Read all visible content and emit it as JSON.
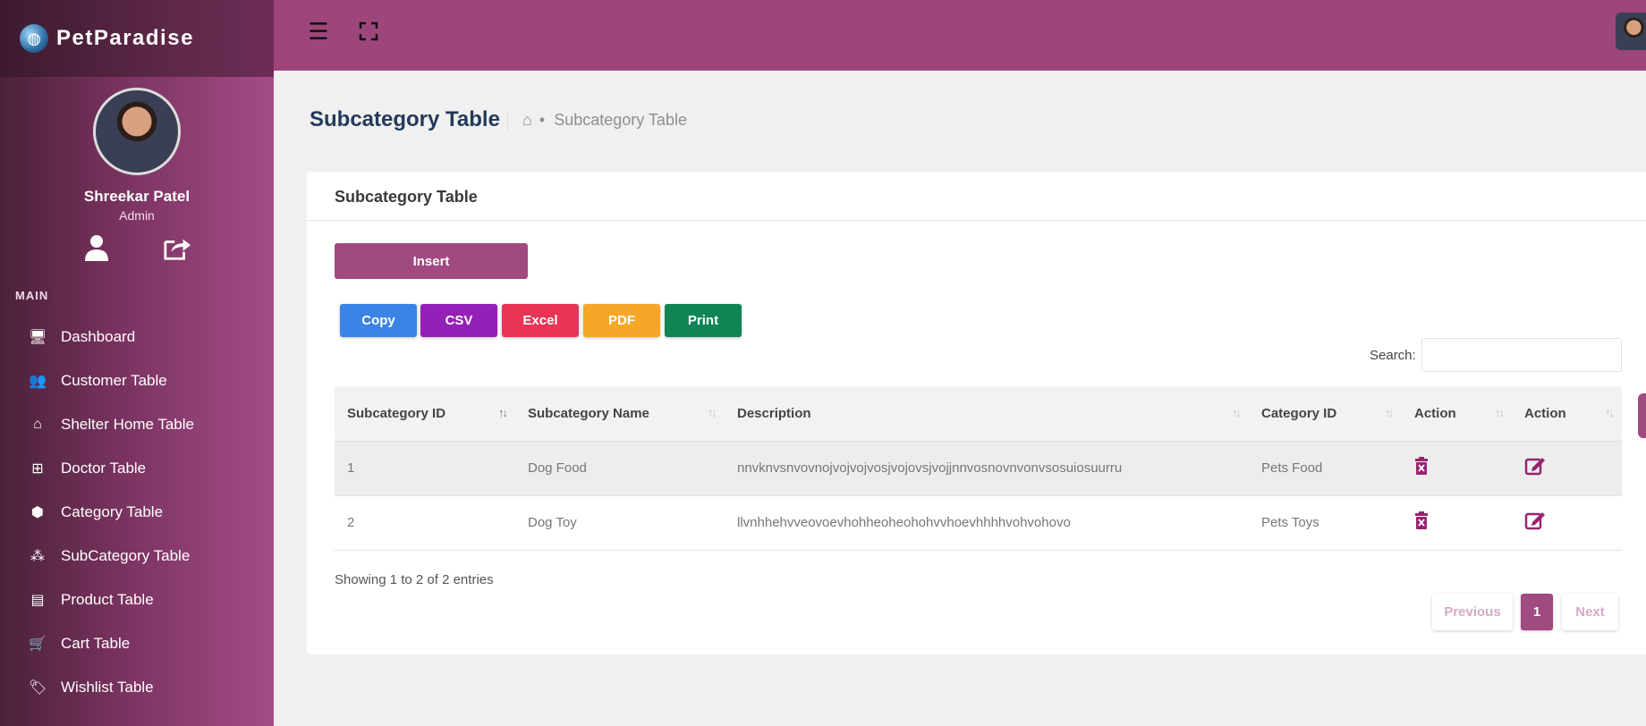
{
  "brand": {
    "name": "PetParadise"
  },
  "profile": {
    "name": "Shreekar Patel",
    "role": "Admin"
  },
  "sidebar": {
    "section": "MAIN",
    "items": [
      {
        "label": "Dashboard",
        "icon": "monitor-icon"
      },
      {
        "label": "Customer Table",
        "icon": "users-icon"
      },
      {
        "label": "Shelter Home Table",
        "icon": "home-icon"
      },
      {
        "label": "Doctor Table",
        "icon": "medical-plus-icon"
      },
      {
        "label": "Category Table",
        "icon": "cube-icon"
      },
      {
        "label": "SubCategory Table",
        "icon": "cubes-icon"
      },
      {
        "label": "Product Table",
        "icon": "archive-icon"
      },
      {
        "label": "Cart Table",
        "icon": "cart-icon"
      },
      {
        "label": "Wishlist Table",
        "icon": "tags-icon"
      }
    ]
  },
  "page": {
    "title": "Subcategory Table",
    "breadcrumb": "Subcategory Table"
  },
  "card": {
    "title": "Subcategory Table",
    "insert_label": "Insert"
  },
  "exports": [
    {
      "label": "Copy",
      "color": "#3b84e6"
    },
    {
      "label": "CSV",
      "color": "#9520b8"
    },
    {
      "label": "Excel",
      "color": "#e83556"
    },
    {
      "label": "PDF",
      "color": "#f6a727"
    },
    {
      "label": "Print",
      "color": "#0f8454"
    }
  ],
  "search": {
    "label": "Search:",
    "value": ""
  },
  "table": {
    "columns": [
      "Subcategory ID",
      "Subcategory Name",
      "Description",
      "Category ID",
      "Action",
      "Action"
    ],
    "rows": [
      {
        "id": "1",
        "name": "Dog Food",
        "description": "nnvknvsnvovnojvojvojvosjvojovsjvojjnnvosnovnvonvsosuiosuurru",
        "category": "Pets Food"
      },
      {
        "id": "2",
        "name": "Dog Toy",
        "description": "llvnhhehvveovoevhohheoheohohvvhoevhhhhvohvohovo",
        "category": "Pets Toys"
      }
    ]
  },
  "info": "Showing 1 to 2 of 2 entries",
  "pagination": {
    "prev": "Previous",
    "current": "1",
    "next": "Next"
  },
  "colors": {
    "accent": "#a04a80",
    "topbar": "#9e467b"
  }
}
